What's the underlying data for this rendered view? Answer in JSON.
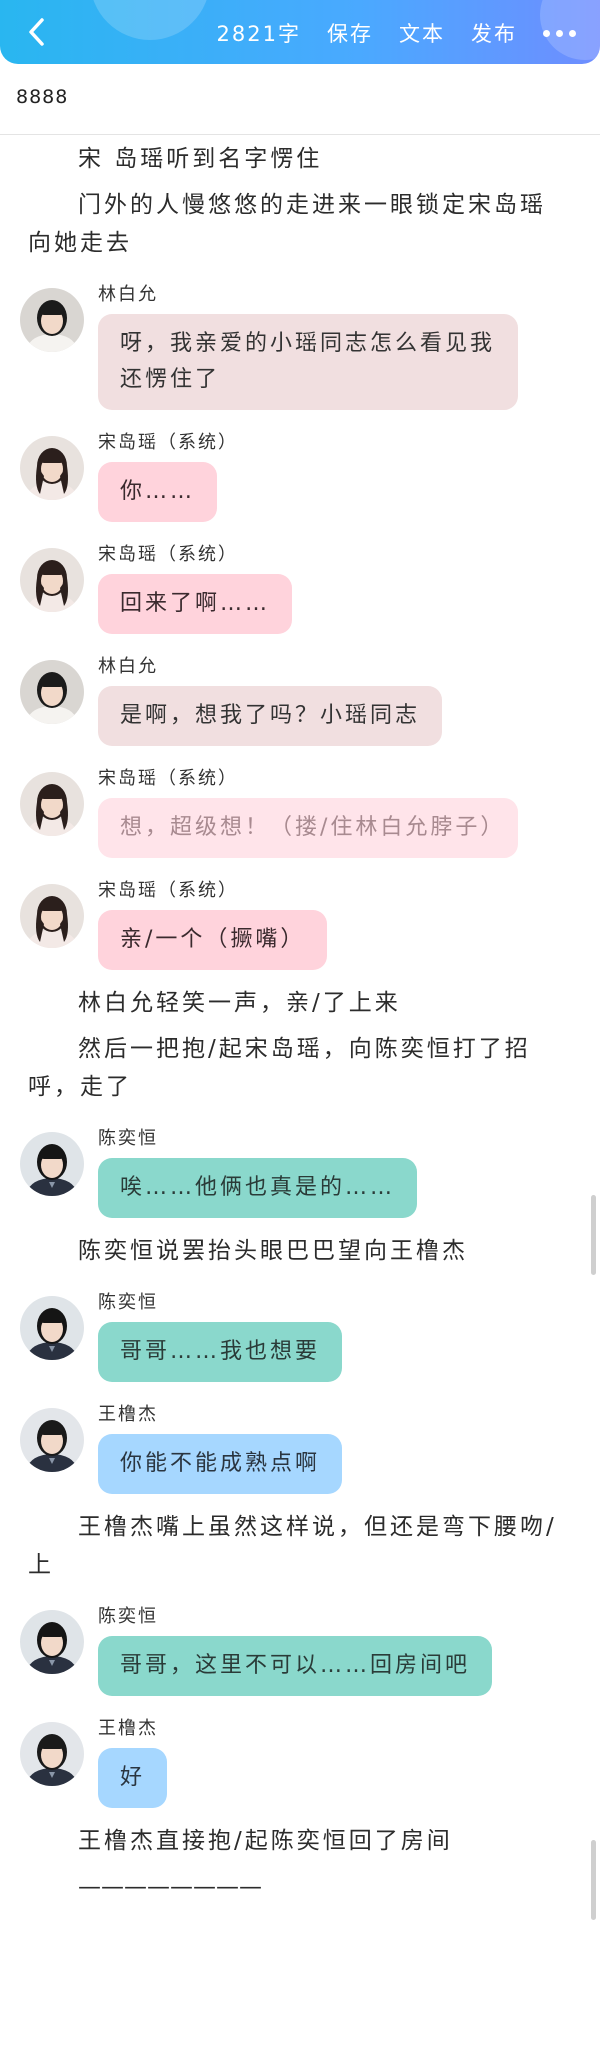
{
  "toolbar": {
    "word_count": "2821字",
    "save_label": "保存",
    "text_label": "文本",
    "publish_label": "发布"
  },
  "document": {
    "title": "8888"
  },
  "blocks": [
    {
      "type": "para",
      "text": "宋 岛瑶听到名字愣住",
      "top": 0
    },
    {
      "type": "para",
      "text": "门外的人慢悠悠的走进来一眼锁定宋岛瑶向她走去",
      "top": 0
    },
    {
      "type": "msg",
      "who": "lin",
      "name": "林白允",
      "text": "呀，我亲爱的小瑶同志怎么看见我还愣住了",
      "style": "b-lin b-wide"
    },
    {
      "type": "msg",
      "who": "song",
      "name": "宋岛瑶（系统）",
      "text": "你……",
      "style": "b-song"
    },
    {
      "type": "msg",
      "who": "song",
      "name": "宋岛瑶（系统）",
      "text": "回来了啊……",
      "style": "b-song"
    },
    {
      "type": "msg",
      "who": "lin",
      "name": "林白允",
      "text": "是啊，想我了吗？小瑶同志",
      "style": "b-lin"
    },
    {
      "type": "msg",
      "who": "song",
      "name": "宋岛瑶（系统）",
      "text": "想，超级想！（搂/住林白允脖子）",
      "style": "b-song-light"
    },
    {
      "type": "msg",
      "who": "song",
      "name": "宋岛瑶（系统）",
      "text": "亲/一个（撅嘴）",
      "style": "b-song"
    },
    {
      "type": "para",
      "text": "林白允轻笑一声，亲/了上来"
    },
    {
      "type": "para",
      "text": "然后一把抱/起宋岛瑶，向陈奕恒打了招呼，走了"
    },
    {
      "type": "msg",
      "who": "chen",
      "name": "陈奕恒",
      "text": "唉……他俩也真是的……",
      "style": "b-chen"
    },
    {
      "type": "para",
      "text": "陈奕恒说罢抬头眼巴巴望向王橹杰"
    },
    {
      "type": "msg",
      "who": "chen",
      "name": "陈奕恒",
      "text": "哥哥……我也想要",
      "style": "b-chen"
    },
    {
      "type": "msg",
      "who": "wang",
      "name": "王橹杰",
      "text": "你能不能成熟点啊",
      "style": "b-wang"
    },
    {
      "type": "para",
      "text": "王橹杰嘴上虽然这样说，但还是弯下腰吻/上"
    },
    {
      "type": "msg",
      "who": "chen",
      "name": "陈奕恒",
      "text": "哥哥，这里不可以……回房间吧",
      "style": "b-chen"
    },
    {
      "type": "msg",
      "who": "wang",
      "name": "王橹杰",
      "text": "好",
      "style": "b-wang"
    },
    {
      "type": "para",
      "text": "王橹杰直接抱/起陈奕恒回了房间"
    },
    {
      "type": "para",
      "text": "————————",
      "noindent": true
    }
  ],
  "icons": {
    "back": "back-chevron-icon",
    "more": "more-dots-icon"
  },
  "colors": {
    "topbar_start": "#29b6f0",
    "topbar_end": "#6f8dff",
    "bubble_lin": "#f1dfe0",
    "bubble_song": "#ffd3dc",
    "bubble_chen": "#8ad8cc",
    "bubble_wang": "#a6d7ff"
  }
}
